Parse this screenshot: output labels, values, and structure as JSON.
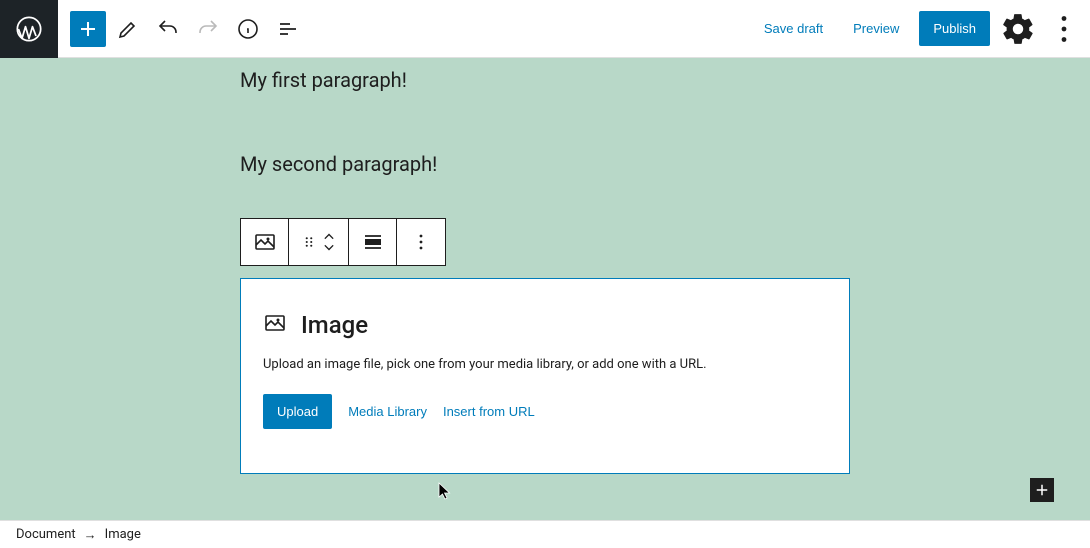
{
  "topbar": {
    "save_draft": "Save draft",
    "preview": "Preview",
    "publish": "Publish"
  },
  "content": {
    "para1": "My first paragraph!",
    "para2": "My second paragraph!"
  },
  "image_block": {
    "title": "Image",
    "description": "Upload an image file, pick one from your media library, or add one with a URL.",
    "upload": "Upload",
    "media_library": "Media Library",
    "insert_url": "Insert from URL"
  },
  "breadcrumb": {
    "root": "Document",
    "current": "Image"
  },
  "colors": {
    "accent": "#007cba",
    "canvas_bg": "#b8d8c8"
  }
}
